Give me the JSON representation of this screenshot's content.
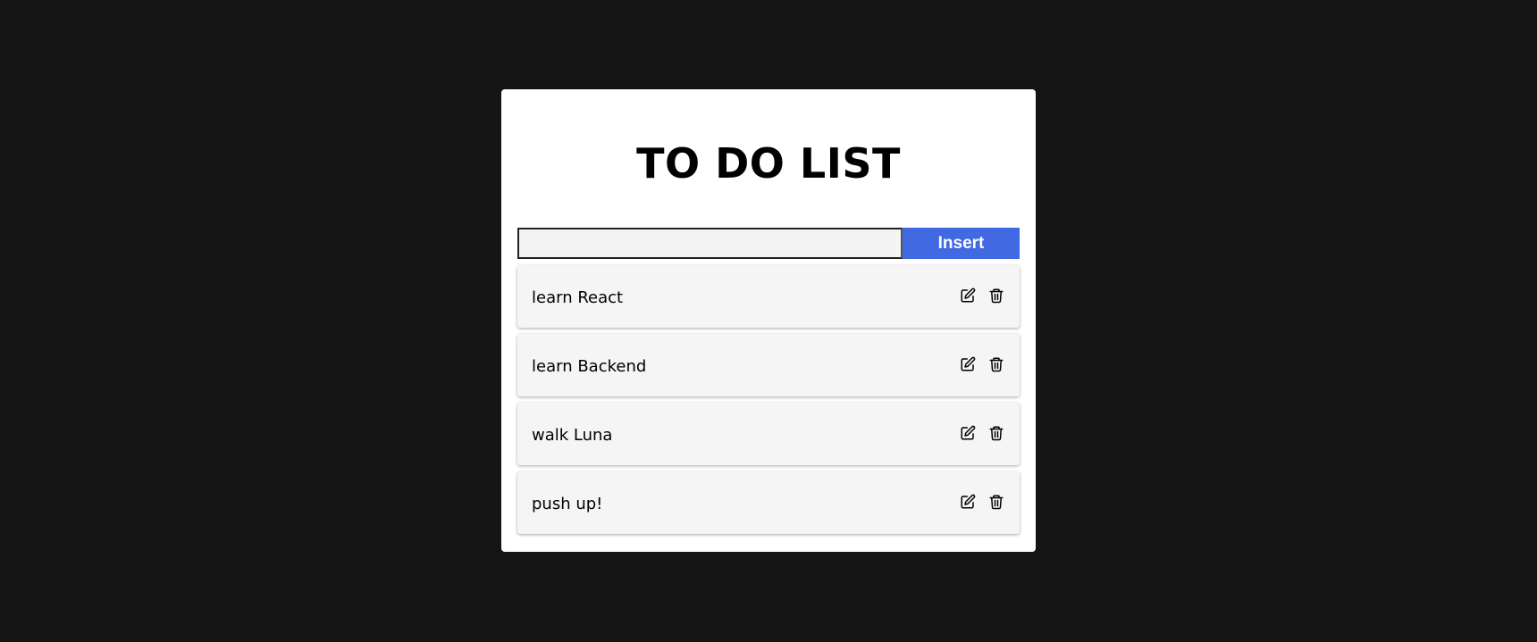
{
  "app": {
    "title": "TO DO LIST"
  },
  "input": {
    "value": "",
    "placeholder": ""
  },
  "buttons": {
    "insert_label": "Insert"
  },
  "todos": [
    {
      "text": "learn React",
      "edit_icon": "edit-icon",
      "delete_icon": "trash-icon"
    },
    {
      "text": "learn Backend",
      "edit_icon": "edit-icon",
      "delete_icon": "trash-icon"
    },
    {
      "text": "walk Luna",
      "edit_icon": "edit-icon",
      "delete_icon": "trash-icon"
    },
    {
      "text": "push up!",
      "edit_icon": "edit-icon",
      "delete_icon": "trash-icon"
    }
  ],
  "colors": {
    "background": "#141414",
    "card": "#ffffff",
    "accent": "#4169e1",
    "item_background": "#f5f5f5"
  }
}
